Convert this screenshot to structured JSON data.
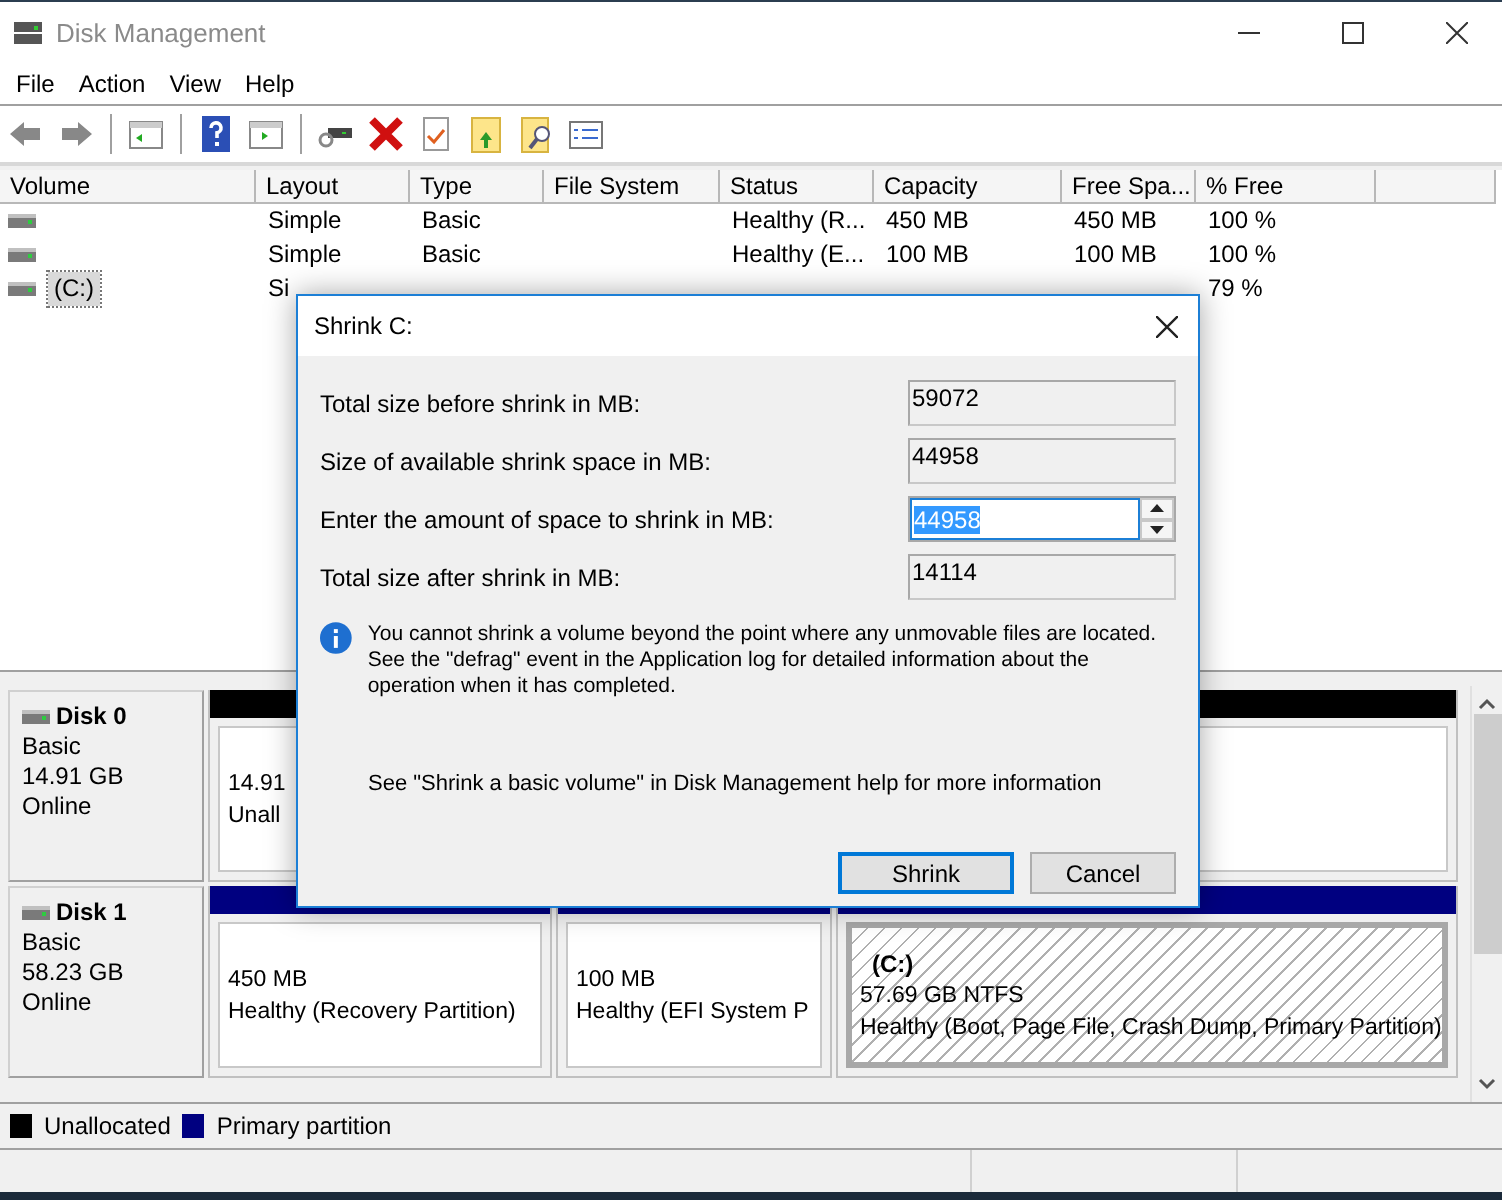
{
  "window": {
    "title": "Disk Management"
  },
  "menu": [
    "File",
    "Action",
    "View",
    "Help"
  ],
  "volume_list": {
    "columns": [
      "Volume",
      "Layout",
      "Type",
      "File System",
      "Status",
      "Capacity",
      "Free Spa...",
      "% Free"
    ],
    "rows": [
      {
        "selected": false,
        "cells": {
          "layout": "Simple",
          "type": "Basic",
          "status": "Healthy (R...",
          "capacity": "450 MB",
          "free": "450 MB",
          "pct": "100 %"
        }
      },
      {
        "selected": false,
        "cells": {
          "layout": "Simple",
          "type": "Basic",
          "status": "Healthy (E...",
          "capacity": "100 MB",
          "free": "100 MB",
          "pct": "100 %"
        }
      },
      {
        "selected": true,
        "cells": {
          "volume": "(C:)",
          "layout": "Si",
          "pct": "79 %"
        }
      }
    ]
  },
  "disks": [
    {
      "name": "Disk 0",
      "type": "Basic",
      "size": "14.91 GB",
      "status": "Online",
      "partitions": [
        {
          "kind": "unallocated",
          "selected": false,
          "lines": [
            "14.91",
            "Unall"
          ]
        }
      ]
    },
    {
      "name": "Disk 1",
      "type": "Basic",
      "size": "58.23 GB",
      "status": "Online",
      "partitions": [
        {
          "kind": "primary",
          "selected": false,
          "lines": [
            "450 MB",
            "Healthy (Recovery Partition)"
          ]
        },
        {
          "kind": "primary",
          "selected": false,
          "lines": [
            "100 MB",
            "Healthy (EFI System P"
          ]
        },
        {
          "kind": "primary",
          "selected": true,
          "label": "(C:)",
          "lines": [
            "57.69 GB NTFS",
            "Healthy (Boot, Page File, Crash Dump, Primary Partition)"
          ]
        }
      ]
    }
  ],
  "legend": [
    {
      "label": "Unallocated",
      "color": "#000000"
    },
    {
      "label": "Primary partition",
      "color": "#000080"
    }
  ],
  "dialog": {
    "title": "Shrink C:",
    "fields": [
      {
        "kind": "readonly",
        "label": "Total size before shrink in MB:",
        "value": "59072"
      },
      {
        "kind": "readonly",
        "label": "Size of available shrink space in MB:",
        "value": "44958"
      },
      {
        "kind": "spin",
        "label": "Enter the amount of space to shrink in MB:",
        "value": "44958"
      },
      {
        "kind": "readonly",
        "label": "Total size after shrink in MB:",
        "value": "14114"
      }
    ],
    "info": "You cannot shrink a volume beyond the point where any unmovable files are located. See the \"defrag\" event in the Application log for detailed information about the operation when it has completed.",
    "help": "See \"Shrink a basic volume\" in Disk Management help for more information",
    "buttons": [
      {
        "label": "Shrink",
        "default": true
      },
      {
        "label": "Cancel",
        "default": false
      }
    ]
  }
}
